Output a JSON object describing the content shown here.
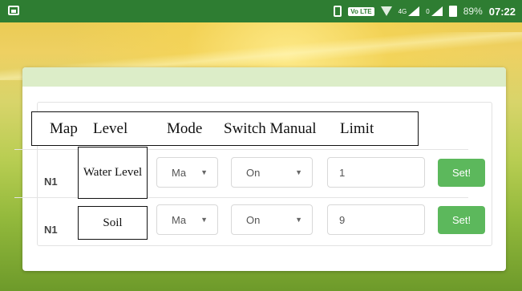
{
  "status_bar": {
    "network_label": "4G",
    "sim_label": "0",
    "volte_label": "Vo LTE",
    "battery_percent": "89%",
    "time": "07:22",
    "icons": [
      "gallery-icon",
      "vibrate-icon",
      "volte-icon",
      "wifi-icon",
      "signal-icon",
      "signal-icon",
      "battery-icon"
    ]
  },
  "table": {
    "headers": {
      "map": "Map",
      "level": "Level",
      "mode": "Mode",
      "switch_manual": "Switch Manual",
      "limit": "Limit"
    },
    "rows": [
      {
        "map": "N1",
        "level": "Water Level",
        "mode": "Ma",
        "switch": "On",
        "limit": "1",
        "button": "Set!"
      },
      {
        "map": "N1",
        "level": "Soil",
        "mode": "Ma",
        "switch": "On",
        "limit": "9",
        "button": "Set!"
      }
    ]
  },
  "colors": {
    "status_bar": "#2e7d32",
    "card_header": "#dcedc8",
    "set_button": "#5cb85c"
  }
}
